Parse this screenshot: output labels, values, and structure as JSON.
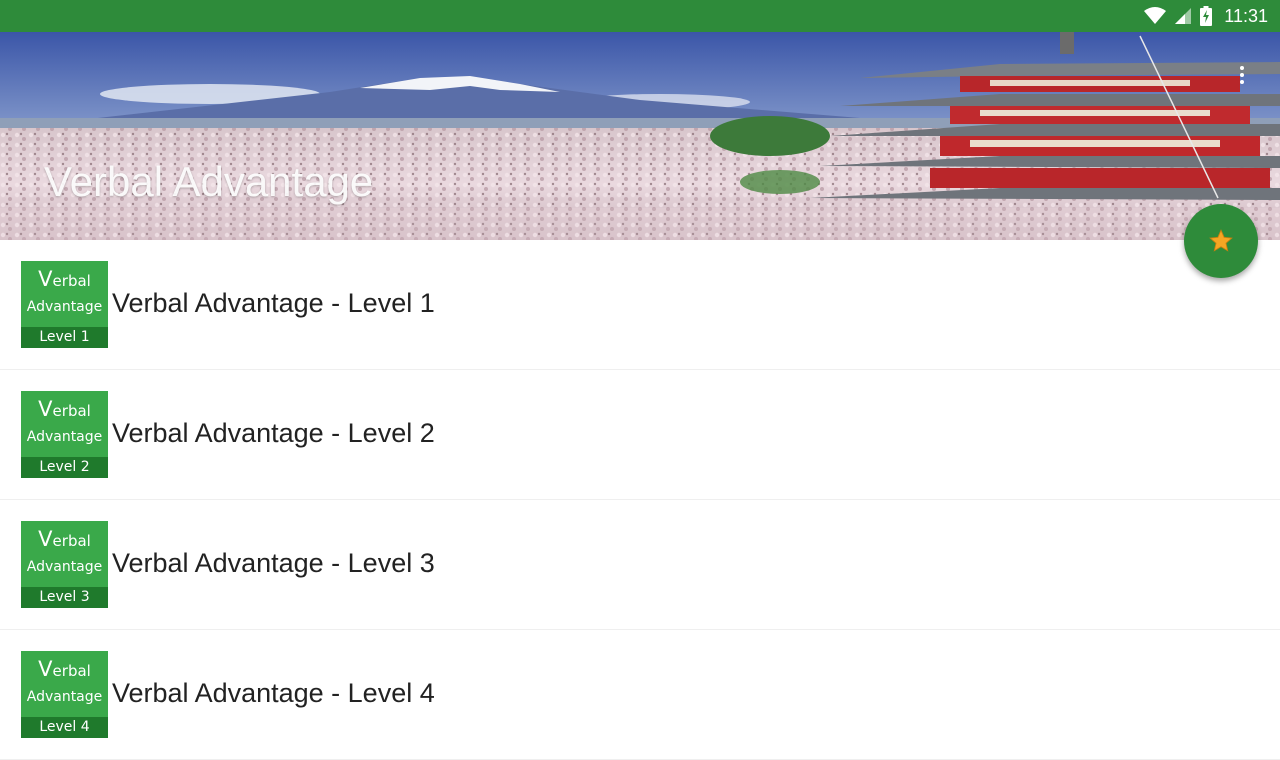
{
  "status_bar": {
    "time": "11:31",
    "icons": [
      "wifi-icon",
      "signal-icon",
      "battery-charging-icon"
    ]
  },
  "header": {
    "title": "Verbal Advantage",
    "menu_icon": "more-vert-icon"
  },
  "fab": {
    "icon": "star-icon"
  },
  "items": [
    {
      "thumb_verbal_initial": "V",
      "thumb_verbal_rest": "erbal",
      "thumb_advantage": "Advantage",
      "thumb_level": "Level 1",
      "title": "Verbal Advantage - Level 1"
    },
    {
      "thumb_verbal_initial": "V",
      "thumb_verbal_rest": "erbal",
      "thumb_advantage": "Advantage",
      "thumb_level": "Level 2",
      "title": "Verbal Advantage - Level 2"
    },
    {
      "thumb_verbal_initial": "V",
      "thumb_verbal_rest": "erbal",
      "thumb_advantage": "Advantage",
      "thumb_level": "Level 3",
      "title": "Verbal Advantage - Level 3"
    },
    {
      "thumb_verbal_initial": "V",
      "thumb_verbal_rest": "erbal",
      "thumb_advantage": "Advantage",
      "thumb_level": "Level 4",
      "title": "Verbal Advantage - Level 4"
    }
  ],
  "colors": {
    "primary": "#2e8b3a",
    "thumb": "#3aa94a",
    "thumb_band": "#1f7a2c",
    "star": "#f5a623"
  }
}
